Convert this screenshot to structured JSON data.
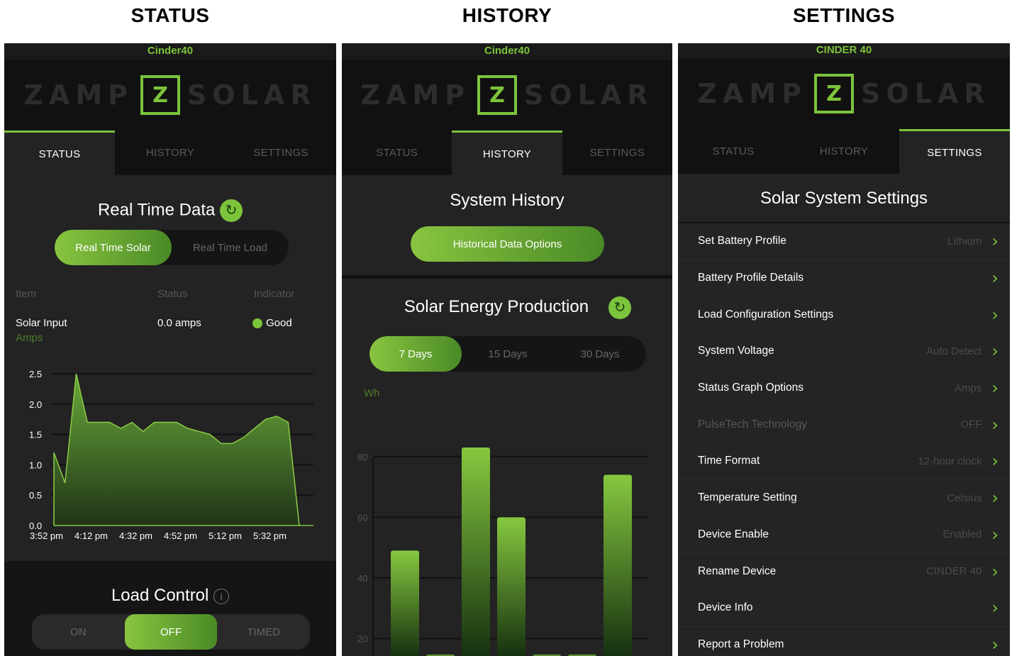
{
  "columns": {
    "status": "STATUS",
    "history": "HISTORY",
    "settings": "SETTINGS"
  },
  "status_screen": {
    "device": "Cinder40",
    "logo": {
      "left": "ZAMP",
      "mark": "Z",
      "right": "SOLAR"
    },
    "tabs": [
      "STATUS",
      "HISTORY",
      "SETTINGS"
    ],
    "title": "Real Time Data",
    "segment": [
      "Real Time Solar",
      "Real Time Load"
    ],
    "table_headers": [
      "Item",
      "Status",
      "Indicator"
    ],
    "row": {
      "item": "Solar Input",
      "status": "0.0 amps",
      "indicator": "Good"
    },
    "unit": "Amps",
    "load_control": {
      "title": "Load Control",
      "options": [
        "ON",
        "OFF",
        "TIMED"
      ],
      "selected": "OFF"
    }
  },
  "history_screen": {
    "device": "Cinder40",
    "tabs": [
      "STATUS",
      "HISTORY",
      "SETTINGS"
    ],
    "title": "System History",
    "options_button": "Historical Data Options",
    "subtitle": "Solar Energy Production",
    "ranges": [
      "7 Days",
      "15 Days",
      "30 Days"
    ],
    "unit": "Wh"
  },
  "settings_screen": {
    "device": "CINDER 40",
    "tabs": [
      "STATUS",
      "HISTORY",
      "SETTINGS"
    ],
    "title": "Solar System Settings",
    "items": [
      {
        "label": "Set Battery Profile",
        "value": "Lithium"
      },
      {
        "label": "Battery Profile Details",
        "value": ""
      },
      {
        "label": "Load Configuration Settings",
        "value": ""
      },
      {
        "label": "System Voltage",
        "value": "Auto Detect"
      },
      {
        "label": "Status Graph Options",
        "value": "Amps"
      },
      {
        "label": "PulseTech Technology",
        "value": "OFF"
      },
      {
        "label": "Time Format",
        "value": "12-hour clock"
      },
      {
        "label": "Temperature Setting",
        "value": "Celsius"
      },
      {
        "label": "Device Enable",
        "value": "Enabled"
      },
      {
        "label": "Rename Device",
        "value": "CINDER 40"
      },
      {
        "label": "Device Info",
        "value": ""
      },
      {
        "label": "Report a Problem",
        "value": ""
      }
    ]
  },
  "chart_data": [
    {
      "type": "area",
      "x": [
        "3:52 pm",
        "4:12 pm",
        "4:32 pm",
        "4:52 pm",
        "5:12 pm",
        "5:32 pm"
      ],
      "ylim": [
        0,
        2.5
      ],
      "yticks": [
        "0.0",
        "0.5",
        "1.0",
        "1.5",
        "2.0",
        "2.5"
      ],
      "series": [
        {
          "values": [
            1.2,
            0.7,
            2.5,
            1.7,
            1.7,
            1.7,
            1.6,
            1.7,
            1.55,
            1.7,
            1.7,
            1.7,
            1.6,
            1.55,
            1.5,
            1.35,
            1.35,
            1.45,
            1.6,
            1.75,
            1.8,
            1.7,
            0
          ]
        }
      ]
    },
    {
      "type": "bar",
      "ylim": [
        0,
        90
      ],
      "yticks": [
        "20",
        "40",
        "60",
        "80"
      ],
      "ylabel": "Wh",
      "values": [
        49,
        0,
        83,
        60,
        0,
        0,
        74
      ]
    }
  ]
}
